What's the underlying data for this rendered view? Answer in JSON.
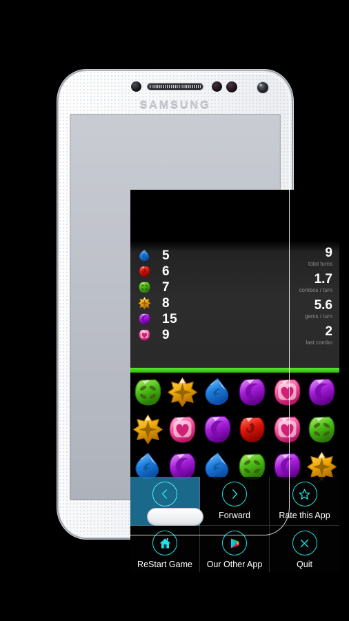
{
  "device": {
    "brand": "SAMSUNG",
    "frame_color": "#f2f4f7"
  },
  "screen": {
    "background": "#000000",
    "divider_color": "#3fd31a"
  },
  "stats": {
    "gem_counts": [
      {
        "gem": "water-drop-gem-icon",
        "color": "#2a9bf0",
        "value": "5"
      },
      {
        "gem": "fire-gem-icon",
        "color": "#e81d12",
        "value": "6"
      },
      {
        "gem": "leaf-gem-icon",
        "color": "#55c41c",
        "value": "7"
      },
      {
        "gem": "star-gem-icon",
        "color": "#f3b611",
        "value": "8"
      },
      {
        "gem": "moon-gem-icon",
        "color": "#b42ae0",
        "value": "15"
      },
      {
        "gem": "heart-gem-icon",
        "color": "#f561a6",
        "value": "9"
      }
    ],
    "summary": [
      {
        "value": "9",
        "label": "total turns"
      },
      {
        "value": "1.7",
        "label": "combos / turn"
      },
      {
        "value": "5.6",
        "label": "gems / turn"
      },
      {
        "value": "2",
        "label": "last combo"
      }
    ]
  },
  "board": {
    "rows": [
      [
        "leaf",
        "star",
        "water",
        "moon",
        "heart",
        "moon"
      ],
      [
        "star",
        "heart",
        "moon",
        "fire",
        "heart",
        "leaf"
      ],
      [
        "water",
        "moon",
        "water",
        "leaf",
        "moon",
        "star"
      ]
    ]
  },
  "menu": {
    "highlight_color": "#1e789e",
    "icon_color": "#25e0e0",
    "items": [
      {
        "label": "Back",
        "icon": "chevron-left-circle-icon",
        "selected": true
      },
      {
        "label": "Forward",
        "icon": "chevron-right-circle-icon",
        "selected": false
      },
      {
        "label": "Rate this App",
        "icon": "star-circle-icon",
        "selected": false
      },
      {
        "label": "ReStart Game",
        "icon": "home-circle-icon",
        "selected": false
      },
      {
        "label": "Our Other App",
        "icon": "play-store-circle-icon",
        "selected": false
      },
      {
        "label": "Quit",
        "icon": "close-circle-icon",
        "selected": false
      }
    ]
  }
}
